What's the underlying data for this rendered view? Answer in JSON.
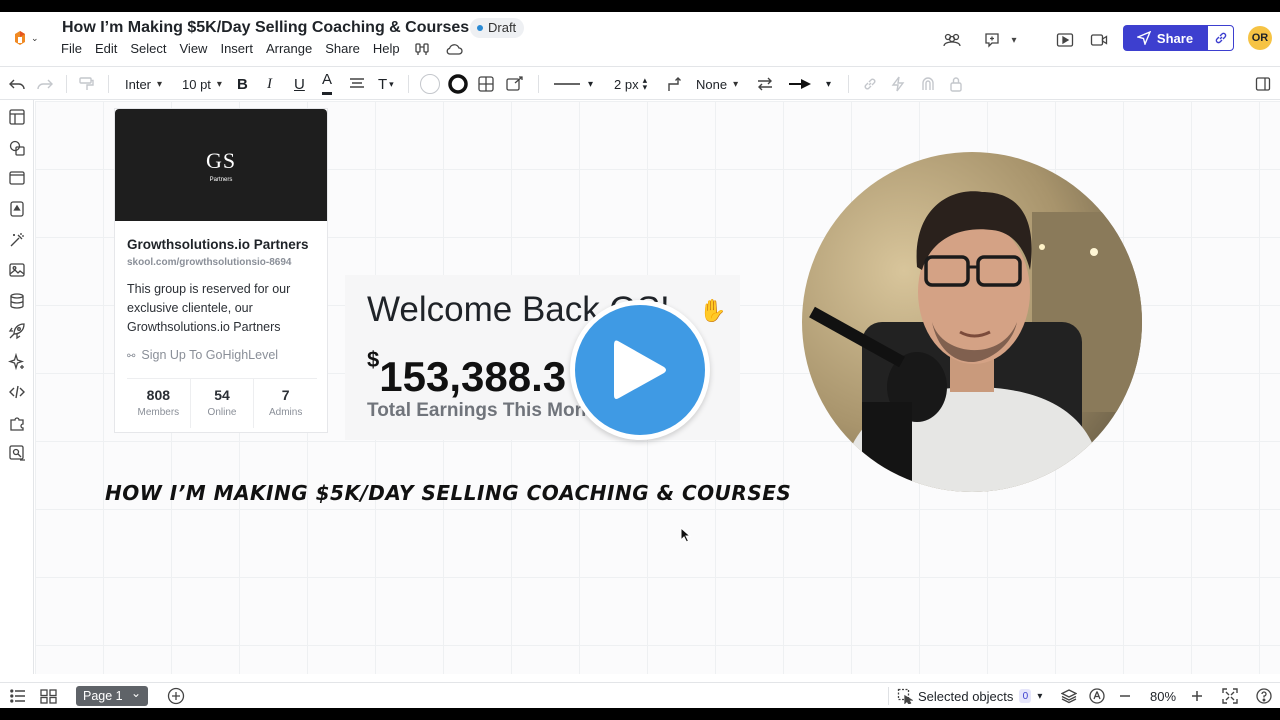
{
  "header": {
    "title": "How I’m Making $5K/Day Selling Coaching & Courses",
    "status": "Draft",
    "menu": [
      "File",
      "Edit",
      "Select",
      "View",
      "Insert",
      "Arrange",
      "Share",
      "Help"
    ],
    "share_label": "Share",
    "user_initials": "OR"
  },
  "toolbar": {
    "font_family": "Inter",
    "font_size": "10 pt",
    "bold": "B",
    "italic": "I",
    "underline": "U",
    "font_color": "A",
    "text_options": "T",
    "line_width": "2 px",
    "arrow_start": "None"
  },
  "canvas": {
    "group_card": {
      "logo_text": "GS",
      "logo_sub": "Partners",
      "name": "Growthsolutions.io Partners",
      "url": "skool.com/growthsolutionsio-8694",
      "description": "This group is reserved for our exclusive clientele, our Growthsolutions.io Partners",
      "link": "Sign Up To GoHighLevel",
      "stats": [
        {
          "value": "808",
          "label": "Members"
        },
        {
          "value": "54",
          "label": "Online"
        },
        {
          "value": "7",
          "label": "Admins"
        }
      ]
    },
    "earnings_card": {
      "greeting": "Welcome Back OS!",
      "currency": "$",
      "amount": "153,388.3",
      "label": "Total Earnings This Month"
    },
    "heading": "HOW I’M MAKING $5K/DAY SELLING COACHING & COURSES"
  },
  "bottombar": {
    "page_label": "Page 1",
    "selected_label": "Selected objects",
    "selected_count": "0",
    "zoom": "80%"
  },
  "colors": {
    "accent": "#3d3fcf",
    "play_button": "#3f9ae4",
    "avatar_bg": "#f6c344",
    "draft_dot": "#2a8ad4"
  }
}
